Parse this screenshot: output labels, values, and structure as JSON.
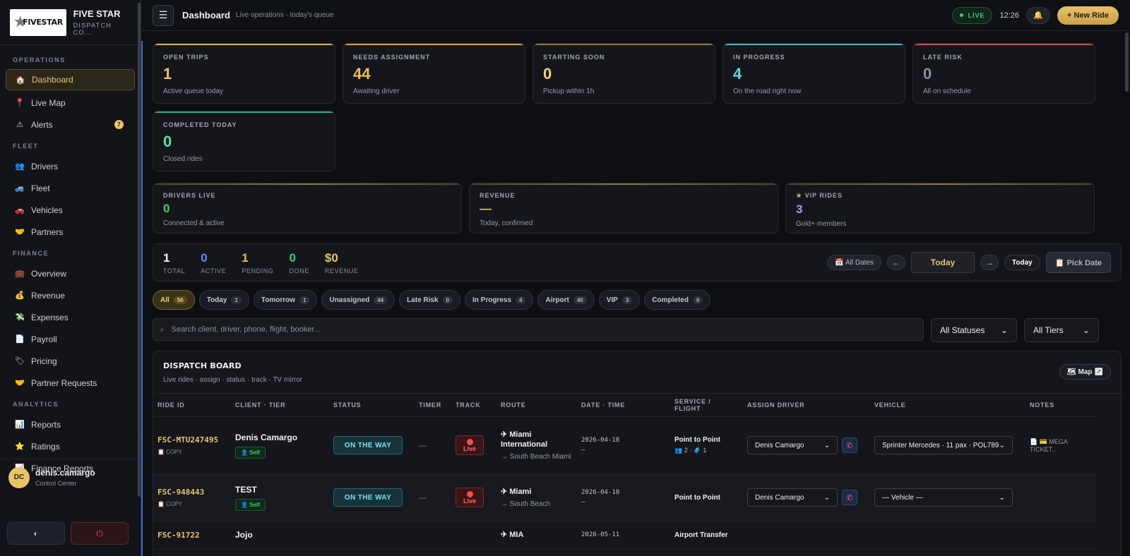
{
  "brand": {
    "logo_text": "FIVESTAR",
    "title": "FIVE STAR",
    "subtitle": "DISPATCH CO..."
  },
  "sidebar": {
    "sections": [
      {
        "label": "OPERATIONS",
        "items": [
          {
            "label": "Dashboard",
            "icon": "home-icon",
            "glyph": "🏠",
            "active": true
          },
          {
            "label": "Live Map",
            "icon": "pin-icon",
            "glyph": "📍"
          },
          {
            "label": "Alerts",
            "icon": "warning-icon",
            "glyph": "⚠",
            "badge": "7"
          }
        ]
      },
      {
        "label": "FLEET",
        "items": [
          {
            "label": "Drivers",
            "icon": "people-icon",
            "glyph": "👥"
          },
          {
            "label": "Fleet",
            "icon": "truck-icon",
            "glyph": "🚙"
          },
          {
            "label": "Vehicles",
            "icon": "car-icon",
            "glyph": "🚗"
          },
          {
            "label": "Partners",
            "icon": "handshake-icon",
            "glyph": "🤝"
          }
        ]
      },
      {
        "label": "FINANCE",
        "items": [
          {
            "label": "Overview",
            "icon": "briefcase-icon",
            "glyph": "💼"
          },
          {
            "label": "Revenue",
            "icon": "moneybag-icon",
            "glyph": "💰"
          },
          {
            "label": "Expenses",
            "icon": "money-wings-icon",
            "glyph": "💸"
          },
          {
            "label": "Payroll",
            "icon": "document-icon",
            "glyph": "📄"
          },
          {
            "label": "Pricing",
            "icon": "tag-icon",
            "glyph": "🏷"
          },
          {
            "label": "Partner Requests",
            "icon": "handshake-icon",
            "glyph": "🤝"
          }
        ]
      },
      {
        "label": "ANALYTICS",
        "items": [
          {
            "label": "Reports",
            "icon": "bar-chart-icon",
            "glyph": "📊"
          },
          {
            "label": "Ratings",
            "icon": "star-icon",
            "glyph": "⭐"
          },
          {
            "label": "Finance Reports",
            "icon": "line-chart-icon",
            "glyph": "📈"
          }
        ]
      }
    ],
    "user": {
      "initials": "DC",
      "name": "denis.camargo",
      "role": "Control Center"
    },
    "theme_glyph": "◐",
    "logout_glyph": "⏻"
  },
  "topbar": {
    "title": "Dashboard",
    "subtitle": "Live operations · today's queue",
    "live": "LIVE",
    "time": "12:26",
    "new_ride": "+ New Ride",
    "bell_glyph": "🔔"
  },
  "kpis": [
    {
      "label": "OPEN TRIPS",
      "value": "1",
      "sub": "Active queue today",
      "color": "#d9b24a",
      "value_color": "#e8c468"
    },
    {
      "label": "NEEDS ASSIGNMENT",
      "value": "44",
      "sub": "Awaiting driver",
      "color": "#e0a030",
      "value_color": "#f2c14e"
    },
    {
      "label": "STARTING SOON",
      "value": "0",
      "sub": "Pickup within 1h",
      "color": "#8a7a3a",
      "value_color": "#f0d27a"
    },
    {
      "label": "IN PROGRESS",
      "value": "4",
      "sub": "On the road right now",
      "color": "#3fb6c9",
      "value_color": "#5fd3e8"
    },
    {
      "label": "LATE RISK",
      "value": "0",
      "sub": "All on schedule",
      "color": "#d94a4a",
      "value_color": "#8a909a"
    },
    {
      "label": "COMPLETED TODAY",
      "value": "0",
      "sub": "Closed rides",
      "color": "#2fae7a",
      "value_color": "#5fe0a8"
    }
  ],
  "kpis2": [
    {
      "label": "DRIVERS LIVE",
      "value": "0",
      "sub": "Connected & active",
      "value_color": "#3bd16f"
    },
    {
      "label": "REVENUE",
      "value": "—",
      "sub": "Today, confirmed",
      "value_color": "#e8c468"
    },
    {
      "label": "★ VIP RIDES",
      "value": "3",
      "sub": "Gold+ members",
      "value_color": "#a99cf0"
    }
  ],
  "summary": [
    {
      "value": "1",
      "label": "TOTAL",
      "color": "#f2f2f2"
    },
    {
      "value": "0",
      "label": "ACTIVE",
      "color": "#5a8cff"
    },
    {
      "value": "1",
      "label": "PENDING",
      "color": "#f2b84e"
    },
    {
      "value": "0",
      "label": "DONE",
      "color": "#3bd16f"
    },
    {
      "value": "$0",
      "label": "REVENUE",
      "color": "#e8c468"
    }
  ],
  "datectl": {
    "all_dates": "📅 All Dates",
    "prev": "←",
    "current": "Today",
    "next": "→",
    "today": "Today",
    "pick": "📋 Pick Date"
  },
  "filters": [
    {
      "label": "All",
      "count": "56",
      "on": true
    },
    {
      "label": "Today",
      "count": "1"
    },
    {
      "label": "Tomorrow",
      "count": "1"
    },
    {
      "label": "Unassigned",
      "count": "44"
    },
    {
      "label": "Late Risk",
      "count": "0"
    },
    {
      "label": "In Progress",
      "count": "4"
    },
    {
      "label": "Airport",
      "count": "40"
    },
    {
      "label": "VIP",
      "count": "3"
    },
    {
      "label": "Completed",
      "count": "6"
    }
  ],
  "search": {
    "placeholder": "Search client, driver, phone, flight, booker..."
  },
  "status_select": "All Statuses",
  "tier_select": "All Tiers",
  "board": {
    "title": "DISPATCH BOARD",
    "subtitle": "Live rides · assign · status · track · TV mirror",
    "map": "🗺 Map ↗",
    "columns": [
      "RIDE ID",
      "CLIENT · TIER",
      "STATUS",
      "TIMER",
      "TRACK",
      "ROUTE",
      "DATE · TIME",
      "SERVICE / FLIGHT",
      "ASSIGN DRIVER",
      "VEHICLE",
      "NOTES"
    ],
    "rows": [
      {
        "id": "FSC-MTU247495",
        "copy": "📋 COPY",
        "client": "Denis Camargo",
        "tier": "👤 Self",
        "status": "ON THE WAY",
        "timer": "—",
        "track": "Live",
        "from": "✈ Miami International",
        "to": "→ South Beach Miami",
        "date": "2026-04-18",
        "time": "—",
        "service": "Point to Point",
        "service_sub": "👥 2 · 🧳 1",
        "driver": "Denis Camargo",
        "vehicle": "Sprinter Mercedes · 11 pax · POL789",
        "notes": "📄 💳 MEGA TICKET..."
      },
      {
        "id": "FSC-948443",
        "copy": "📋 COPY",
        "client": "TEST",
        "tier": "👤 Self",
        "status": "ON THE WAY",
        "timer": "—",
        "track": "Live",
        "from": "✈ Miami",
        "to": "→ South Beach",
        "date": "2026-04-18",
        "time": "—",
        "service": "Point to Point",
        "service_sub": "",
        "driver": "Denis Camargo",
        "vehicle": "— Vehicle —",
        "notes": ""
      },
      {
        "id": "FSC-91722",
        "client": "Jojo",
        "from": "✈ MIA",
        "date": "2026-05-11",
        "service": "Airport Transfer"
      }
    ]
  }
}
